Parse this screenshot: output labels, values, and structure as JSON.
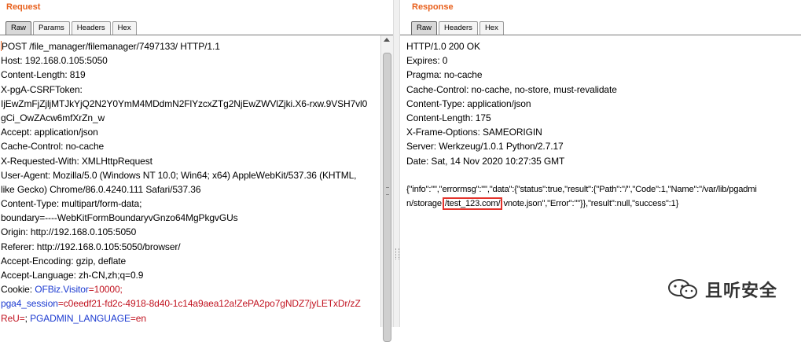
{
  "request": {
    "title": "Request",
    "tabs": [
      "Raw",
      "Params",
      "Headers",
      "Hex"
    ],
    "lines": [
      "POST /file_manager/filemanager/7497133/ HTTP/1.1",
      "Host: 192.168.0.105:5050",
      "Content-Length: 819",
      "X-pgA-CSRFToken:",
      "IjEwZmFjZjljMTJkYjQ2N2Y0YmM4MDdmN2FlYzcxZTg2NjEwZWVlZjki.X6-rxw.9VSH7vl0",
      "gCi_OwZAcw6mfXrZn_w",
      "Accept: application/json",
      "Cache-Control: no-cache",
      "X-Requested-With: XMLHttpRequest",
      "User-Agent: Mozilla/5.0 (Windows NT 10.0; Win64; x64) AppleWebKit/537.36 (KHTML,",
      "like Gecko) Chrome/86.0.4240.111 Safari/537.36",
      "Content-Type: multipart/form-data;",
      "boundary=----WebKitFormBoundaryvGnzo64MgPkgvGUs",
      "Origin: http://192.168.0.105:5050",
      "Referer: http://192.168.0.105:5050/browser/",
      "Accept-Encoding: gzip, deflate",
      "Accept-Language: zh-CN,zh;q=0.9"
    ],
    "cookie": {
      "prefix": "Cookie: ",
      "name1": "OFBiz.Visitor",
      "value1": "=10000;",
      "name2": "pga4_session",
      "value2_part1": "=c0eedf21-fd2c-4918-8d40-1c14a9aea12a!ZePA2po7gNDZ7jyLETxDr/zZ",
      "value2_part2": "ReU=",
      "sep": "; ",
      "name3": "PGADMIN_LANGUAGE",
      "value3": "=en"
    }
  },
  "response": {
    "title": "Response",
    "tabs": [
      "Raw",
      "Headers",
      "Hex"
    ],
    "lines": [
      "HTTP/1.0 200 OK",
      "Expires: 0",
      "Pragma: no-cache",
      "Cache-Control: no-cache, no-store, must-revalidate",
      "Content-Type: application/json",
      "Content-Length: 175",
      "X-Frame-Options: SAMEORIGIN",
      "Server: Werkzeug/1.0.1 Python/2.7.17",
      "Date: Sat, 14 Nov 2020 10:27:35 GMT"
    ],
    "body_line1": "{\"info\":\"\",\"errormsg\":\"\",\"data\":{\"status\":true,\"result\":{\"Path\":\"/\",\"Code\":1,\"Name\":\"/var/lib/pgadmi",
    "body_line2_pre": "n/storage",
    "body_line2_highlight": "/test_123.com/",
    "body_line2_post": "vnote.json\",\"Error\":\"\"}},\"result\":null,\"success\":1}"
  },
  "watermark": {
    "icon": "wechat-icon",
    "text": "且听安全"
  }
}
